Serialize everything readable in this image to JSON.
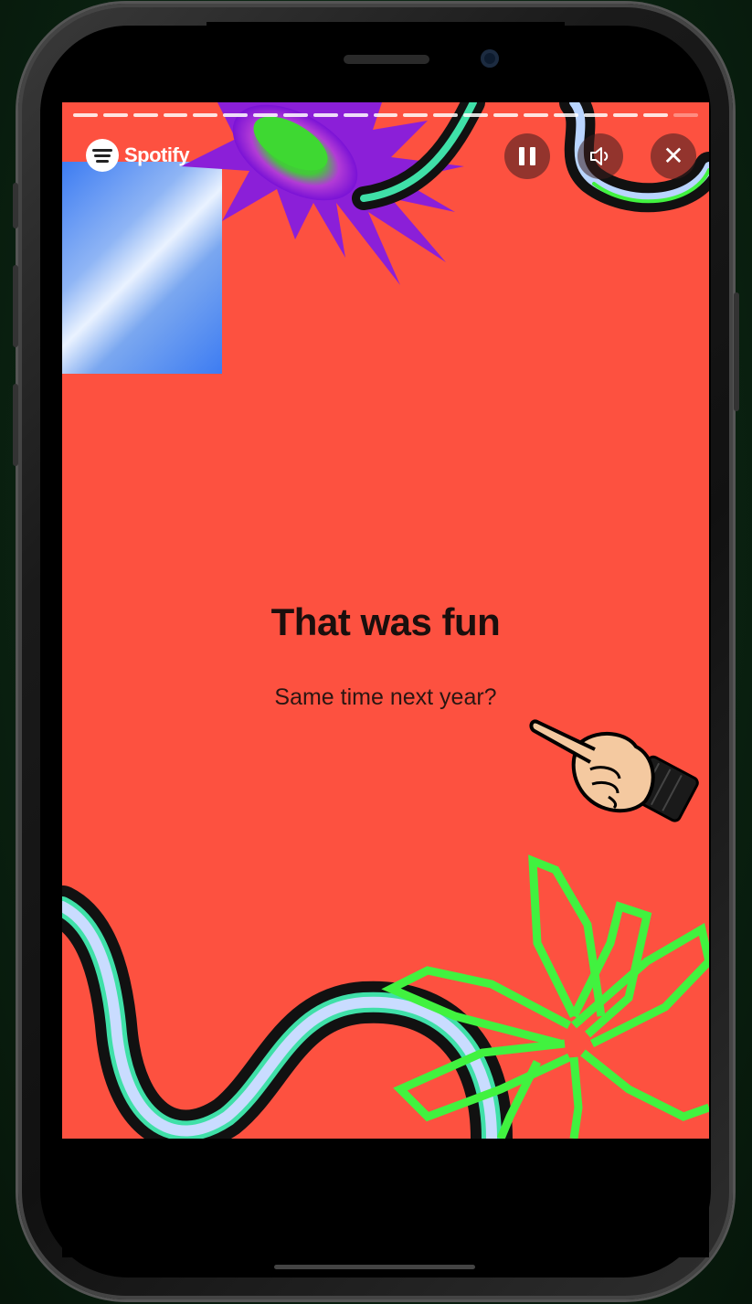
{
  "app": {
    "brand": "Spotify"
  },
  "controls": {
    "pause_icon": "pause-icon",
    "volume_icon": "volume-icon",
    "close_icon": "close-icon",
    "close_glyph": "✕"
  },
  "story": {
    "title": "That was fun",
    "subtitle": "Same time next year?"
  },
  "colors": {
    "background": "#fd5140",
    "accent_green": "#41f23f",
    "blue": "#3d7cf2",
    "purple": "#8b1fd8"
  }
}
